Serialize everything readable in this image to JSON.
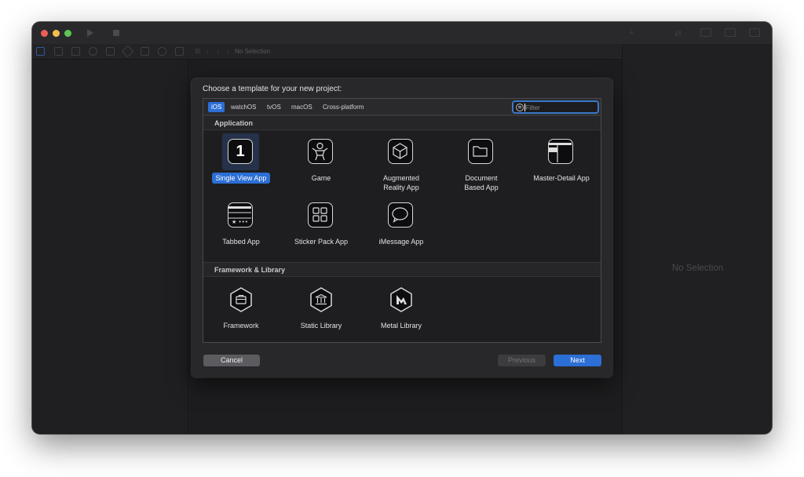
{
  "window": {
    "jump_bar_text": "No Selection",
    "inspector_empty_text": "No Selection"
  },
  "sheet": {
    "title": "Choose a template for your new project:",
    "platform_tabs": [
      {
        "label": "iOS",
        "active": true
      },
      {
        "label": "watchOS",
        "active": false
      },
      {
        "label": "tvOS",
        "active": false
      },
      {
        "label": "macOS",
        "active": false
      },
      {
        "label": "Cross-platform",
        "active": false
      }
    ],
    "filter": {
      "placeholder": "Filter",
      "value": ""
    },
    "sections": [
      {
        "title": "Application",
        "templates": [
          {
            "label": "Single View App",
            "icon": "single-view-app-icon",
            "selected": true
          },
          {
            "label": "Game",
            "icon": "game-icon",
            "selected": false
          },
          {
            "label": "Augmented Reality App",
            "icon": "augmented-reality-icon",
            "selected": false
          },
          {
            "label": "Document Based App",
            "icon": "document-based-icon",
            "selected": false
          },
          {
            "label": "Master-Detail App",
            "icon": "master-detail-icon",
            "selected": false
          },
          {
            "label": "Tabbed App",
            "icon": "tabbed-app-icon",
            "selected": false
          },
          {
            "label": "Sticker Pack App",
            "icon": "sticker-pack-icon",
            "selected": false
          },
          {
            "label": "iMessage App",
            "icon": "imessage-icon",
            "selected": false
          }
        ]
      },
      {
        "title": "Framework & Library",
        "templates": [
          {
            "label": "Framework",
            "icon": "framework-icon",
            "selected": false
          },
          {
            "label": "Static Library",
            "icon": "static-library-icon",
            "selected": false
          },
          {
            "label": "Metal Library",
            "icon": "metal-library-icon",
            "selected": false
          }
        ]
      }
    ],
    "buttons": {
      "cancel": "Cancel",
      "previous": "Previous",
      "next": "Next"
    },
    "single_view_icon_glyph": "1"
  },
  "colors": {
    "accent": "#2c6fd6",
    "window_bg": "#1e1e20",
    "sheet_bg": "#28282b"
  }
}
